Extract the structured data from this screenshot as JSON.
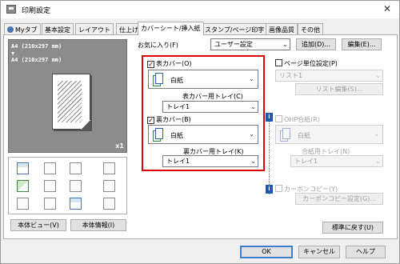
{
  "window": {
    "title": "印刷設定",
    "close": "✕"
  },
  "tabs": [
    "Myタブ",
    "基本設定",
    "レイアウト",
    "仕上げ",
    "カバーシート/挿入紙",
    "スタンプ/ページ印字",
    "画像品質",
    "その他"
  ],
  "preview": {
    "size_lines": [
      "A4 (210x297 mm)",
      "▼",
      "A4 (210x297 mm)"
    ],
    "copies": "x1"
  },
  "left_buttons": {
    "view": "本体ビュー(V)",
    "info": "本体情報(I)"
  },
  "favorites": {
    "label": "お気に入り(F)",
    "value": "ユーザー設定",
    "add": "追加(D)...",
    "edit": "編集(E)..."
  },
  "front_cover": {
    "checkbox": "表カバー(O)",
    "checked": true,
    "paper": "白紙",
    "tray_label": "表カバー用トレイ(C)",
    "tray": "トレイ1"
  },
  "back_cover": {
    "checkbox": "裏カバー(B)",
    "checked": true,
    "paper": "白紙",
    "tray_label": "裏カバー用トレイ(K)",
    "tray": "トレイ1"
  },
  "per_page": {
    "checkbox": "ページ単位設定(P)",
    "checked": false,
    "list": "リスト1",
    "edit_list": "リスト編集(S)..."
  },
  "ohp": {
    "checkbox": "OHP合紙(R)",
    "checked": false,
    "paper": "白紙",
    "tray_label": "合紙用トレイ(N)",
    "tray": "トレイ1"
  },
  "carbon": {
    "checkbox": "カーボンコピー(Y)",
    "checked": false,
    "settings": "カーボンコピー設定(G)..."
  },
  "defaults_button": "標準に戻す(U)",
  "footer": {
    "ok": "OK",
    "cancel": "キャンセル",
    "help": "ヘルプ"
  },
  "colors": {
    "highlight": "#e00000",
    "accent": "#3c7fd1",
    "info_icon": "#1f56b0"
  }
}
